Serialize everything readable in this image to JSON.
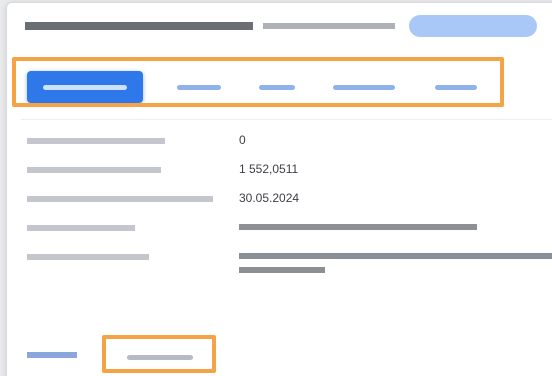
{
  "title": {
    "text": "",
    "meta": "",
    "pill_label": ""
  },
  "tabs": [
    {
      "label": "",
      "active": true
    },
    {
      "label": "",
      "active": false
    },
    {
      "label": "",
      "active": false
    },
    {
      "label": "",
      "active": false
    },
    {
      "label": "",
      "active": false
    }
  ],
  "details": [
    {
      "label": "",
      "value": "0"
    },
    {
      "label": "",
      "value": "1 552,0511"
    },
    {
      "label": "",
      "value": "30.05.2024"
    },
    {
      "label": "",
      "value": ""
    },
    {
      "label": "",
      "value": ""
    }
  ],
  "footer": {
    "link_label": "",
    "button_label": ""
  },
  "colors": {
    "accent": "#2f78e9",
    "highlight": "#f5a445",
    "pill": "#a9c8f7"
  }
}
